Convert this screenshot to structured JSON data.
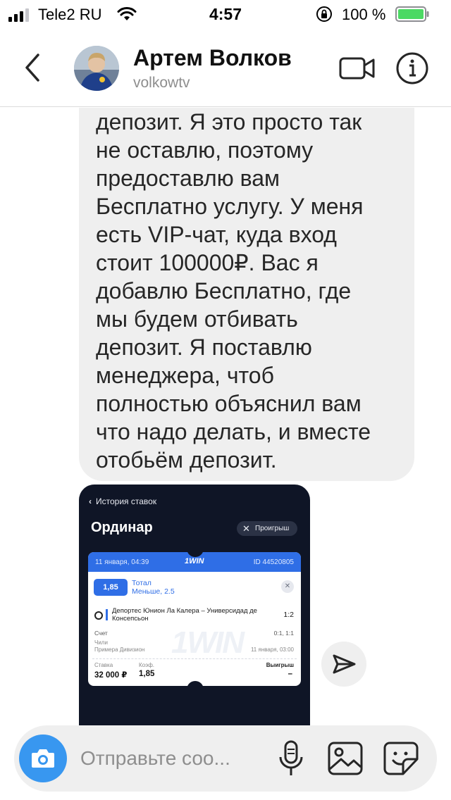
{
  "status_bar": {
    "carrier": "Tele2 RU",
    "time": "4:57",
    "battery": "100 %"
  },
  "header": {
    "name": "Артем Волков",
    "handle": "volkowtv"
  },
  "message": {
    "text": "депозит. Я это просто так\nне оставлю, поэтому\nпредоставлю вам\nБесплатно услугу. У меня\nесть VIP-чат, куда вход\nстоит 100000₽. Вас я\nдобавлю Бесплатно, где\nмы будем отбивать\nдепозит. Я поставлю\nменеджера, чтоб\nполностью объяснил вам\nчто надо делать, и вместе\nотобьём депозит."
  },
  "screenshot": {
    "back_label": "История ставок",
    "title": "Ординар",
    "badge": "Проигрыш",
    "ticket": {
      "date": "11 января, 04:39",
      "logo": "1WIN",
      "id": "ID 44520805",
      "odds": "1,85",
      "bet_line1": "Тотал",
      "bet_line2": "Меньше, 2.5",
      "match": "Депортес Юнион Ла Калера – Универсидад де Консепсьон",
      "score": "1:2",
      "score_label": "Счет",
      "score_detail": "0:1, 1:1",
      "league_country": "Чили",
      "league_name": "Примера Дивизион",
      "match_date": "11 января, 03:00",
      "stake_label": "Ставка",
      "stake_value": "32 000 ₽",
      "coef_label": "Коэф.",
      "coef_value": "1,85",
      "win_label": "Выигрыш",
      "win_value": "–"
    }
  },
  "composer": {
    "placeholder": "Отправьте соо..."
  },
  "colors": {
    "accent": "#3897f0",
    "bubble": "#efefef",
    "ticket_blue": "#2f6ee6"
  }
}
